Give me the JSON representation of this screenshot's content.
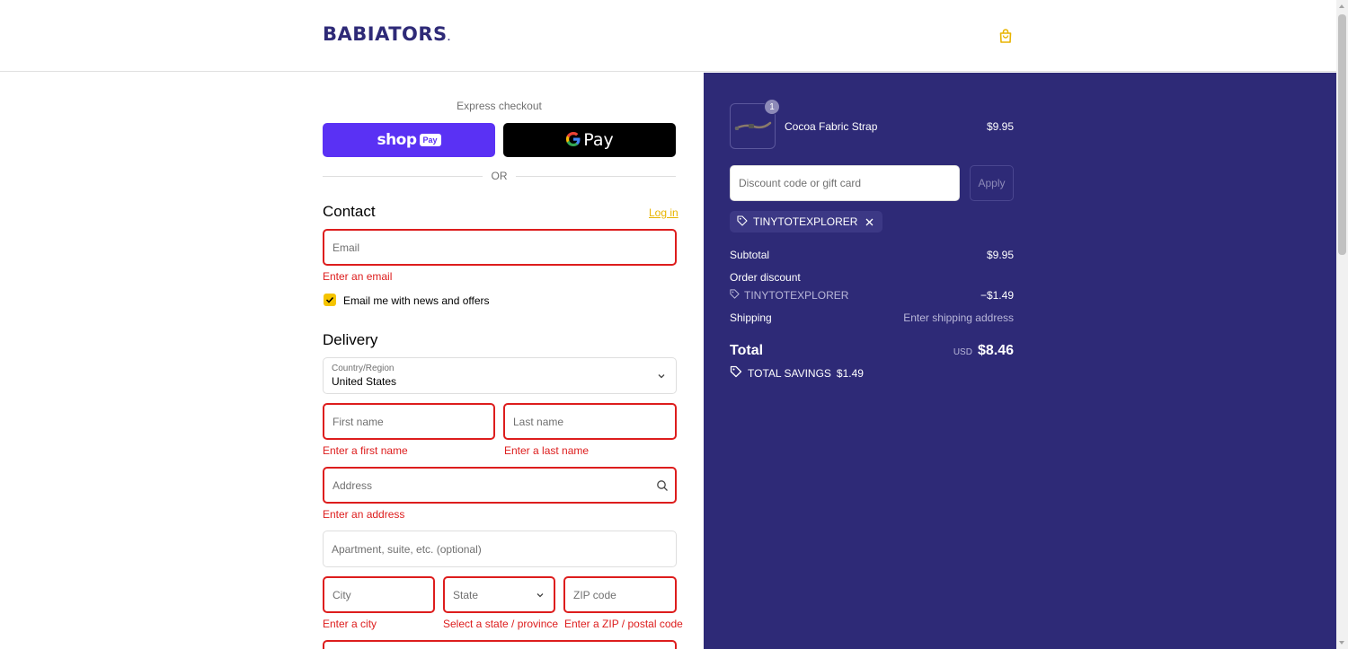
{
  "header": {
    "logo_text": "BABIATORS",
    "logo_mark": ".",
    "cart_icon": "shopping-bag-icon"
  },
  "express": {
    "label": "Express checkout",
    "shop_pay": {
      "word": "shop",
      "badge": "Pay"
    },
    "google_pay": {
      "word": "Pay"
    },
    "or_label": "OR"
  },
  "contact": {
    "title": "Contact",
    "login_label": "Log in",
    "email_placeholder": "Email",
    "email_error": "Enter an email",
    "newsletter_label": "Email me with news and offers",
    "newsletter_checked": true
  },
  "delivery": {
    "title": "Delivery",
    "country_label": "Country/Region",
    "country_value": "United States",
    "first_name_placeholder": "First name",
    "first_name_error": "Enter a first name",
    "last_name_placeholder": "Last name",
    "last_name_error": "Enter a last name",
    "address_placeholder": "Address",
    "address_error": "Enter an address",
    "apartment_placeholder": "Apartment, suite, etc. (optional)",
    "city_placeholder": "City",
    "city_error": "Enter a city",
    "state_placeholder": "State",
    "state_error": "Select a state / province",
    "zip_placeholder": "ZIP code",
    "zip_error": "Enter a ZIP / postal code"
  },
  "order": {
    "item": {
      "name": "Cocoa Fabric Strap",
      "price": "$9.95",
      "quantity": "1"
    },
    "discount_placeholder": "Discount code or gift card",
    "apply_label": "Apply",
    "applied_code": "TINYTOTEXPLORER",
    "subtotal_label": "Subtotal",
    "subtotal_value": "$9.95",
    "order_discount_label": "Order discount",
    "discount_code": "TINYTOTEXPLORER",
    "discount_value": "−$1.49",
    "shipping_label": "Shipping",
    "shipping_value": "Enter shipping address",
    "total_label": "Total",
    "total_currency": "USD",
    "total_value": "$8.46",
    "savings_label": "TOTAL SAVINGS",
    "savings_value": "$1.49"
  },
  "colors": {
    "brand_navy": "#2e2a77",
    "accent_yellow": "#f5c400",
    "error_red": "#dd1d1d",
    "shop_pay_purple": "#5a31f4"
  }
}
